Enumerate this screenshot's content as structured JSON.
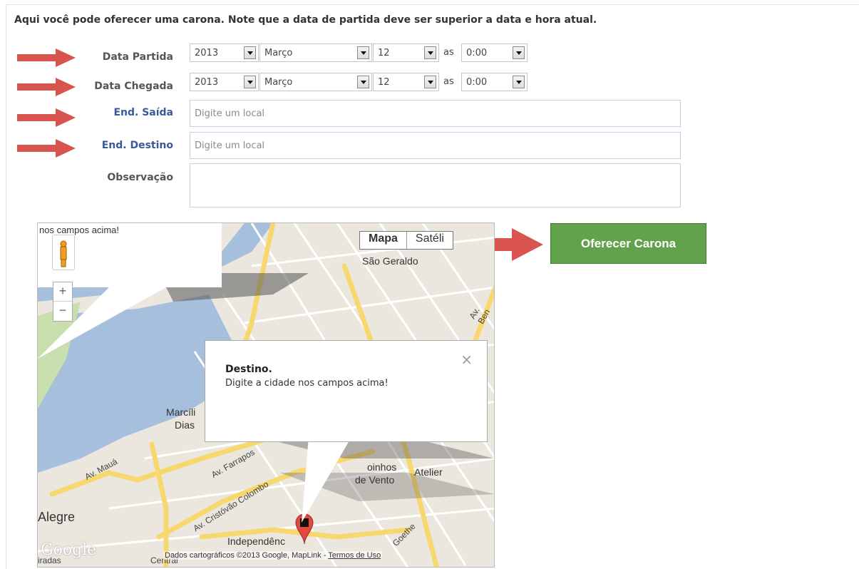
{
  "intro": "Aqui você pode oferecer uma carona. Note que a data de partida deve ser superior a data e hora atual.",
  "form": {
    "departure": {
      "label": "Data Partida",
      "year": "2013",
      "month": "Março",
      "day": "12",
      "as": "as",
      "time": "0:00"
    },
    "arrival": {
      "label": "Data Chegada",
      "year": "2013",
      "month": "Março",
      "day": "12",
      "as": "as",
      "time": "0:00"
    },
    "origin": {
      "label": "End. Saída",
      "placeholder": "Digite um local"
    },
    "destination": {
      "label": "End. Destino",
      "placeholder": "Digite um local"
    },
    "notes": {
      "label": "Observação"
    }
  },
  "submit_label": "Oferecer Carona",
  "colors": {
    "accent_green": "#63a24c",
    "arrow_red": "#d9534f",
    "link_blue": "#3b5998"
  },
  "map": {
    "type_map": "Mapa",
    "type_satellite": "Satéli",
    "small_bubble_text": "nos campos acima!",
    "info_title": "Destino.",
    "info_body": "Digite a cidade nos campos acima!",
    "info_close": "×",
    "zoom_in": "+",
    "zoom_out": "−",
    "labels": {
      "sao_geraldo": "São Geraldo",
      "marcilio_1": "Marcíli",
      "marcilio_2": "Dias",
      "moinhos_1": "oinhos",
      "moinhos_2": "de Vento",
      "atelier": "Atelier",
      "alegre": "Alegre",
      "independencia": "Independênc",
      "av_maua": "Av. Mauá",
      "av_farrapos": "Av. Farrapos",
      "av_cristovao": "Av. Cristóvão Colombo",
      "av_bento": "Av. Ben",
      "goethe": "Goethe",
      "central": "Central",
      "iradas": "iradas"
    },
    "google_logo": "Google",
    "credits": "Dados cartográficos ©2013 Google, MapLink",
    "credits_sep": " - ",
    "terms": "Termos de Uso"
  }
}
